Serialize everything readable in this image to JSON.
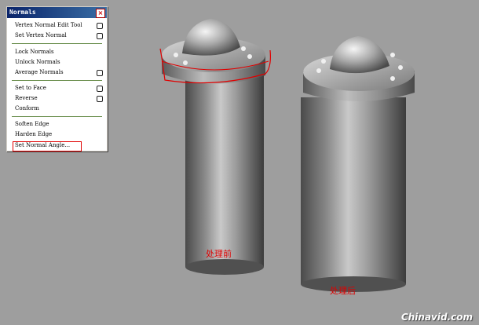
{
  "panel": {
    "title": "Normals",
    "close_glyph": "×",
    "items": [
      {
        "label": "Vertex Normal Edit Tool",
        "has_option": true
      },
      {
        "label": "Set Vertex Normal",
        "has_option": true
      },
      {
        "label": "Lock Normals",
        "has_option": false
      },
      {
        "label": "Unlock Normals",
        "has_option": false
      },
      {
        "label": "Average Normals",
        "has_option": true
      },
      {
        "label": "Set to Face",
        "has_option": true
      },
      {
        "label": "Reverse",
        "has_option": true
      },
      {
        "label": "Conform",
        "has_option": false
      },
      {
        "label": "Soften Edge",
        "has_option": false
      },
      {
        "label": "Harden Edge",
        "has_option": false
      },
      {
        "label": "Set Normal Angle...",
        "has_option": false
      }
    ]
  },
  "labels": {
    "before": "处理前",
    "after": "处理后"
  },
  "watermark": "Chinavid.com",
  "colors": {
    "annotation": "#e00000",
    "viewport_bg": "#9e9e9e",
    "title_bar": "#0a246a"
  }
}
